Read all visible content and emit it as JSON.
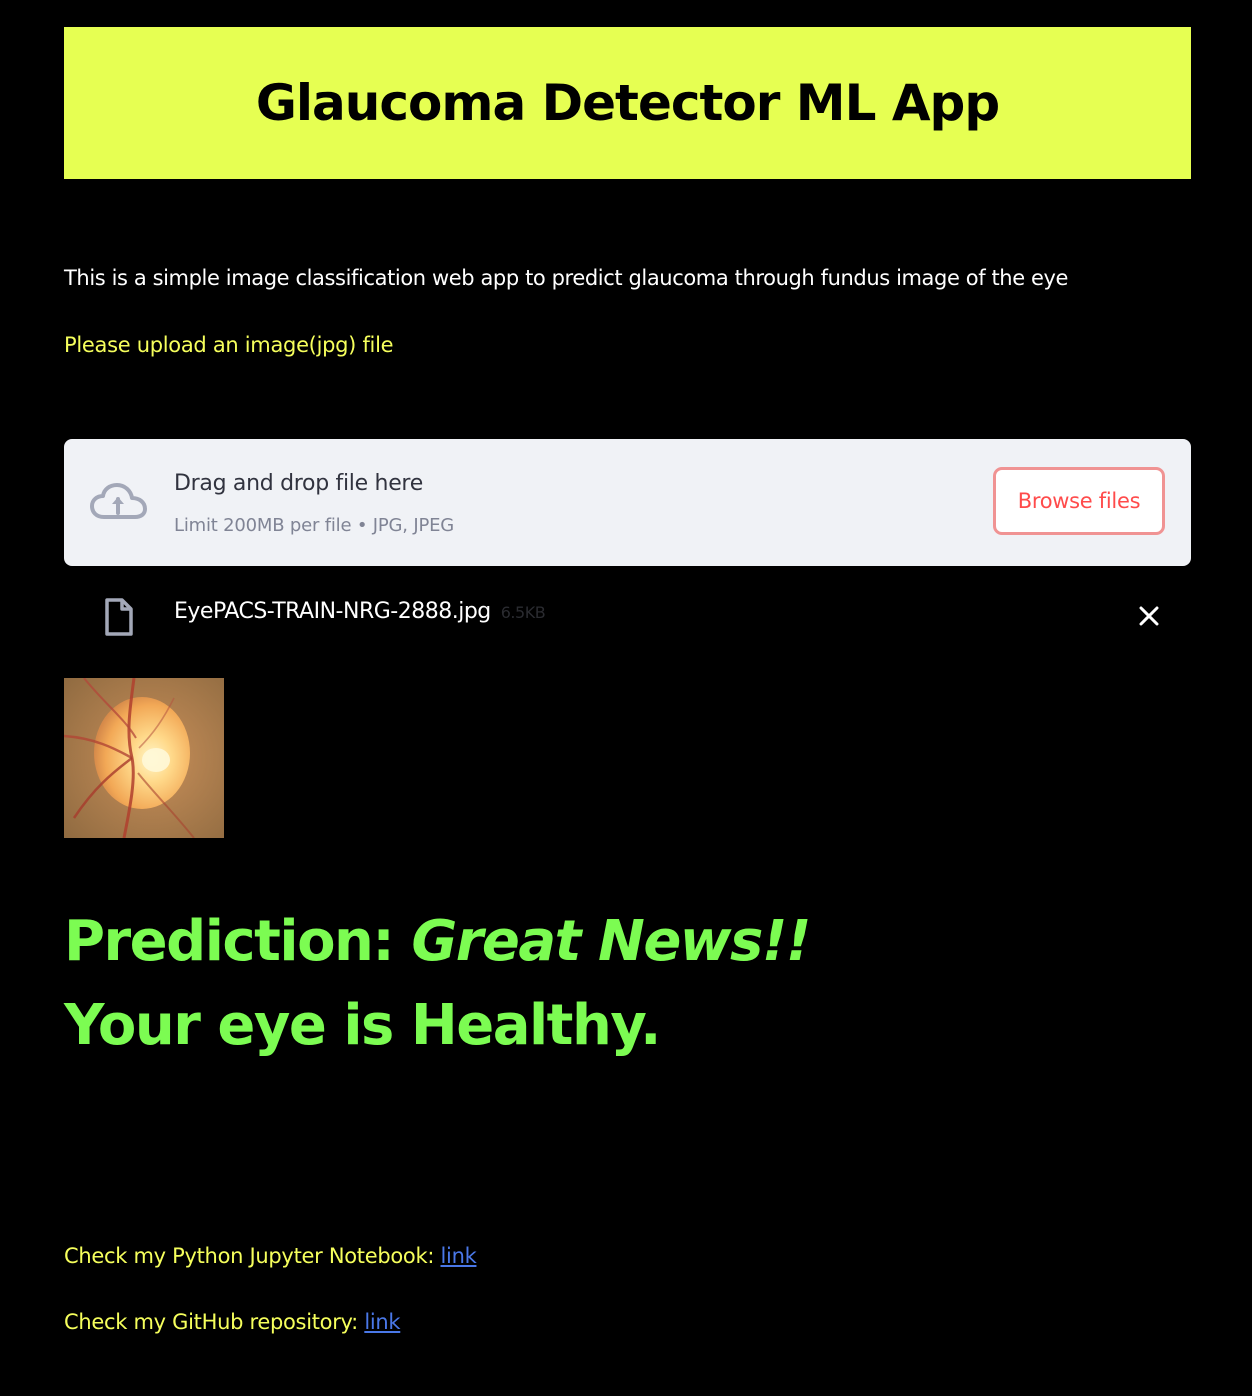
{
  "colors": {
    "page_background": "#000000",
    "header_background": "#e6ff52",
    "header_text": "#000000",
    "highlight_text": "#f6ff5c",
    "prediction_text": "#7cfc52",
    "accent_red": "#ff4b4b",
    "link": "#4a78e8"
  },
  "header": {
    "title": "Glaucoma Detector ML App"
  },
  "main": {
    "description": "This is a simple image classification web app to predict glaucoma through fundus image of the eye",
    "upload_prompt": "Please upload an image(jpg) file"
  },
  "uploader": {
    "drop_title": "Drag and drop file here",
    "drop_limits": "Limit 200MB per file • JPG, JPEG",
    "browse_label": "Browse files",
    "icon": "cloud-upload-icon"
  },
  "uploaded_file": {
    "name": "EyePACS-TRAIN-NRG-2888.jpg",
    "size": "6.5KB",
    "icon": "file-icon",
    "remove_icon": "close-icon"
  },
  "prediction": {
    "label": "Prediction:",
    "headline": "Great News!!",
    "message": "Your eye is Healthy."
  },
  "footer": {
    "notebook_text": "Check my Python Jupyter Notebook:",
    "notebook_link": "link",
    "repo_text": "Check my GitHub repository:",
    "repo_link": "link"
  }
}
